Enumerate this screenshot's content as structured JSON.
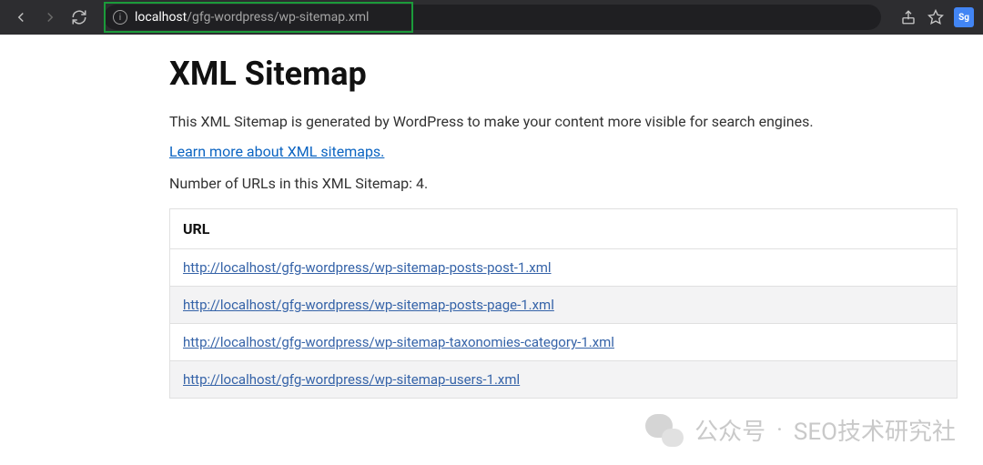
{
  "browser": {
    "url_domain": "localhost",
    "url_path": "/gfg-wordpress/wp-sitemap.xml"
  },
  "page": {
    "title": "XML Sitemap",
    "description": "This XML Sitemap is generated by WordPress to make your content more visible for search engines.",
    "learn_more": "Learn more about XML sitemaps.",
    "count_prefix": "Number of URLs in this XML Sitemap: ",
    "count_value": "4",
    "count_suffix": "."
  },
  "table": {
    "header": "URL",
    "rows": [
      "http://localhost/gfg-wordpress/wp-sitemap-posts-post-1.xml",
      "http://localhost/gfg-wordpress/wp-sitemap-posts-page-1.xml",
      "http://localhost/gfg-wordpress/wp-sitemap-taxonomies-category-1.xml",
      "http://localhost/gfg-wordpress/wp-sitemap-users-1.xml"
    ]
  },
  "watermark": {
    "label": "公众号",
    "sep": " · ",
    "name": "SEO技术研究社"
  },
  "translate_badge": "Sg"
}
